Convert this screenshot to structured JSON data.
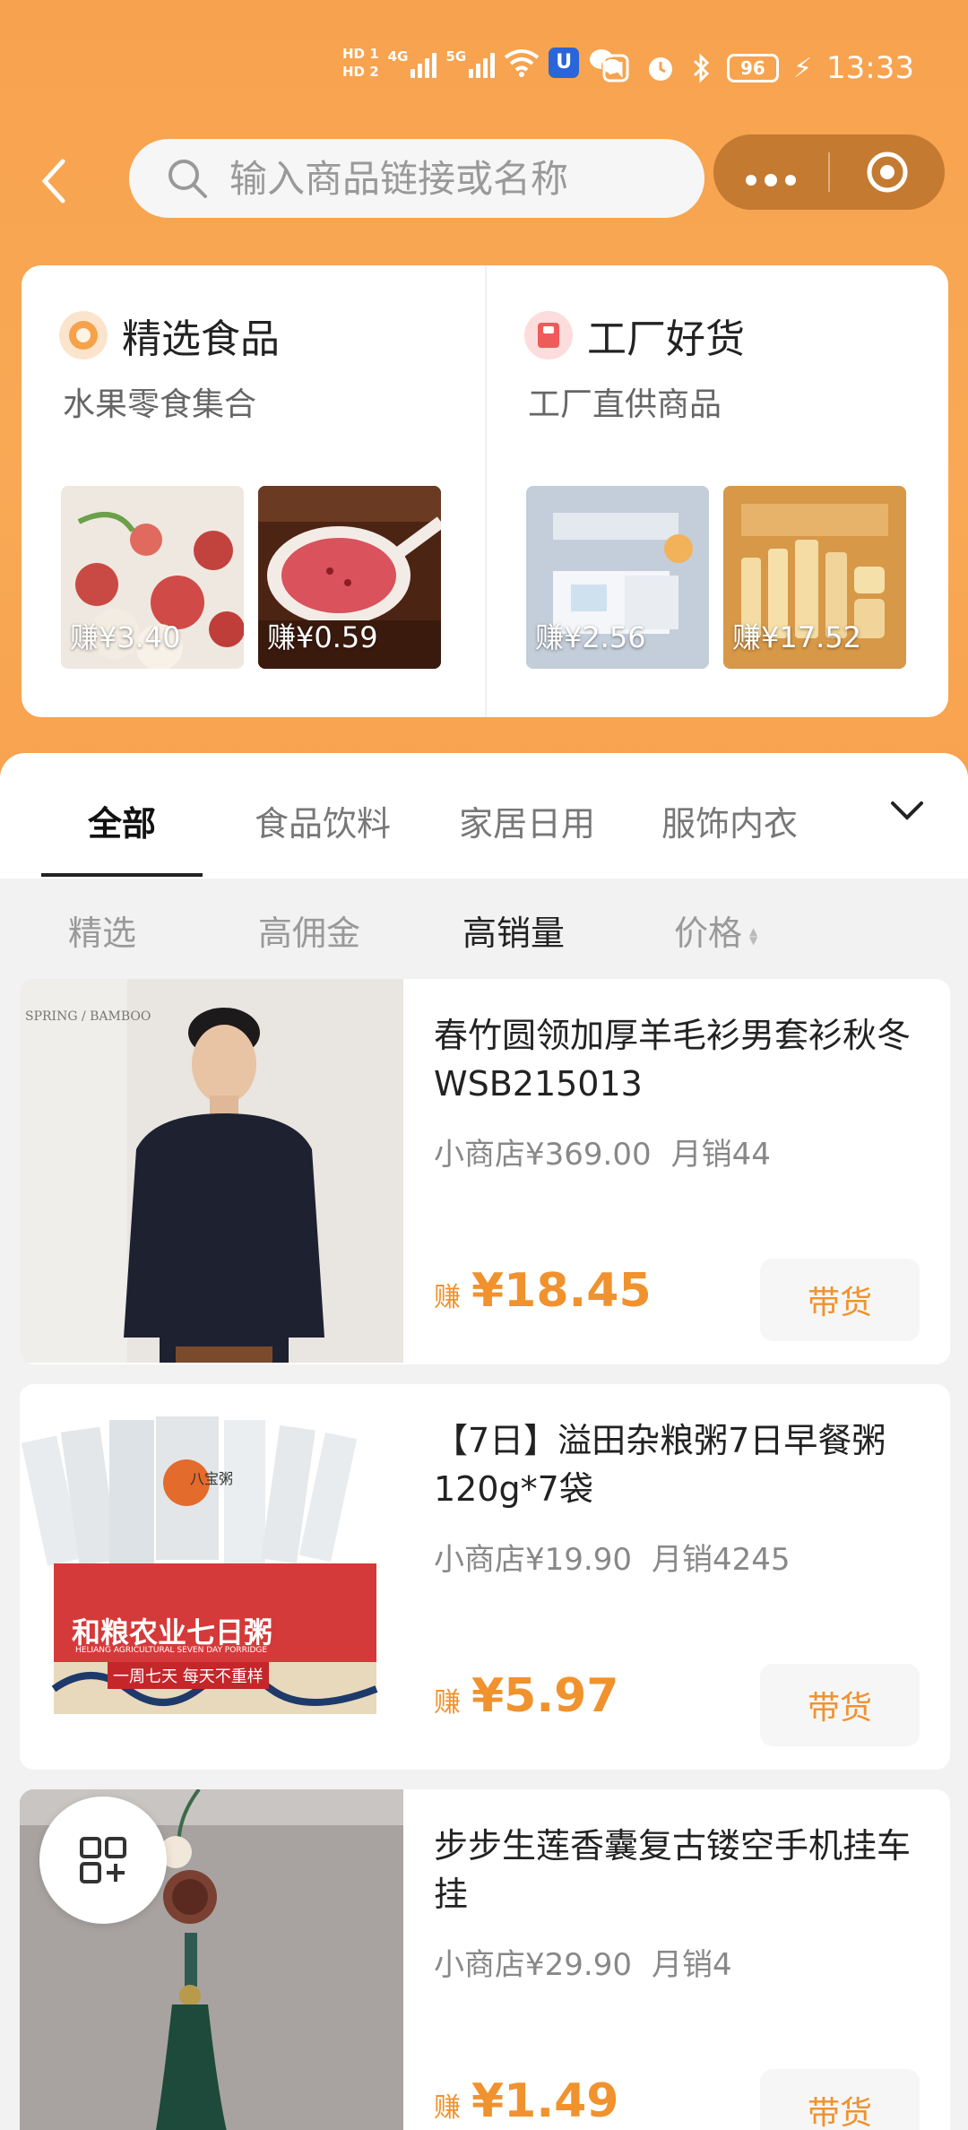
{
  "status_bar": {
    "hd1": "HD 1",
    "hd2": "HD 2",
    "sig1": "4G",
    "sig2": "5G",
    "battery": "96",
    "time": "13:33"
  },
  "nav": {
    "search_placeholder": "输入商品链接或名称"
  },
  "feature": [
    {
      "title": "精选食品",
      "subtitle": "水果零食集合",
      "icon": "orange-circle-icon",
      "products": [
        {
          "earn": "赚¥3.40",
          "image": "lychee"
        },
        {
          "earn": "赚¥0.59",
          "image": "tea-spoon"
        }
      ]
    },
    {
      "title": "工厂好货",
      "subtitle": "工厂直供商品",
      "icon": "red-book-icon",
      "products": [
        {
          "earn": "赚¥2.56",
          "image": "tissue-box"
        },
        {
          "earn": "赚¥17.52",
          "image": "cosmetics-set"
        }
      ]
    }
  ],
  "tabs": [
    "全部",
    "食品饮料",
    "家居日用",
    "服饰内衣"
  ],
  "active_tab": "全部",
  "sort": [
    "精选",
    "高佣金",
    "高销量",
    "价格"
  ],
  "active_sort": "高销量",
  "products": [
    {
      "title": "春竹圆领加厚羊毛衫男套衫秋冬WSB215013",
      "shop_price": "小商店¥369.00",
      "monthly_sales": "月销44",
      "earn_label": "赚",
      "earn": "¥18.45",
      "button": "带货",
      "brand_mark": "SPRING / BAMBOO"
    },
    {
      "title": "【7日】溢田杂粮粥7日早餐粥120g*7袋",
      "shop_price": "小商店¥19.90",
      "monthly_sales": "月销4245",
      "earn_label": "赚",
      "earn": "¥5.97",
      "button": "带货",
      "box_text": "和粮农业七日粥",
      "box_sub": "HELIANG AGRICULTURAL SEVEN DAY PORRIDGE",
      "box_slogan": "一周七天 每天不重样",
      "pkg_label": "八宝粥"
    },
    {
      "title": "步步生莲香囊复古镂空手机挂车挂",
      "shop_price": "小商店¥29.90",
      "monthly_sales": "月销4",
      "earn_label": "赚",
      "earn": "¥1.49",
      "button": "带货"
    }
  ],
  "colors": {
    "header_orange": "#f7a24e",
    "accent": "#f0922e",
    "capsule": "#c47a30"
  }
}
